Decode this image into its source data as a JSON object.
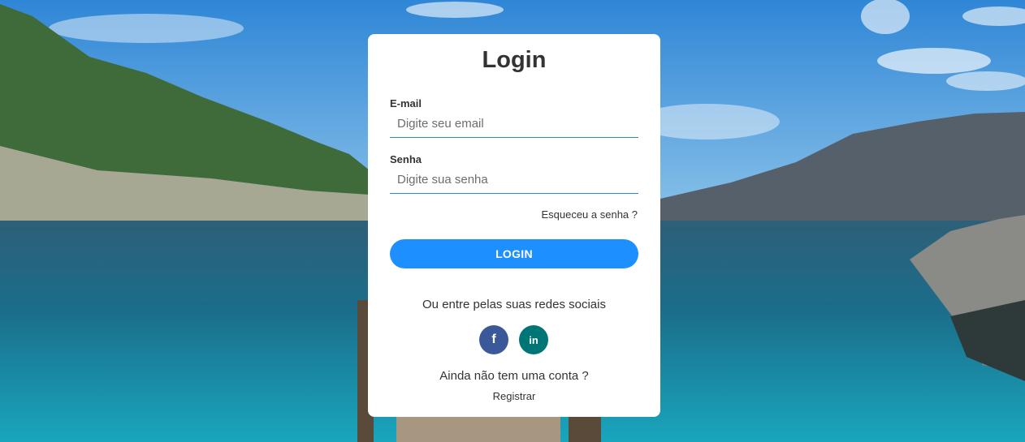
{
  "login_card": {
    "title": "Login",
    "email": {
      "label": "E-mail",
      "placeholder": "Digite seu email",
      "value": ""
    },
    "password": {
      "label": "Senha",
      "placeholder": "Digite sua senha",
      "value": ""
    },
    "forgot_link": "Esqueceu a senha ?",
    "login_button": "LOGIN",
    "social_prompt": "Ou entre pelas suas redes sociais",
    "social_buttons": [
      {
        "icon": "facebook-icon",
        "glyph": "f",
        "color": "#3b5998"
      },
      {
        "icon": "linkedin-icon",
        "glyph": "in",
        "color": "#007575"
      }
    ],
    "no_account_text": "Ainda não tem uma conta ?",
    "register_link": "Registrar"
  },
  "colors": {
    "primary_button": "#1e8fff",
    "input_underline": "#2f86c8",
    "text": "#333333",
    "card_background": "#ffffff"
  }
}
